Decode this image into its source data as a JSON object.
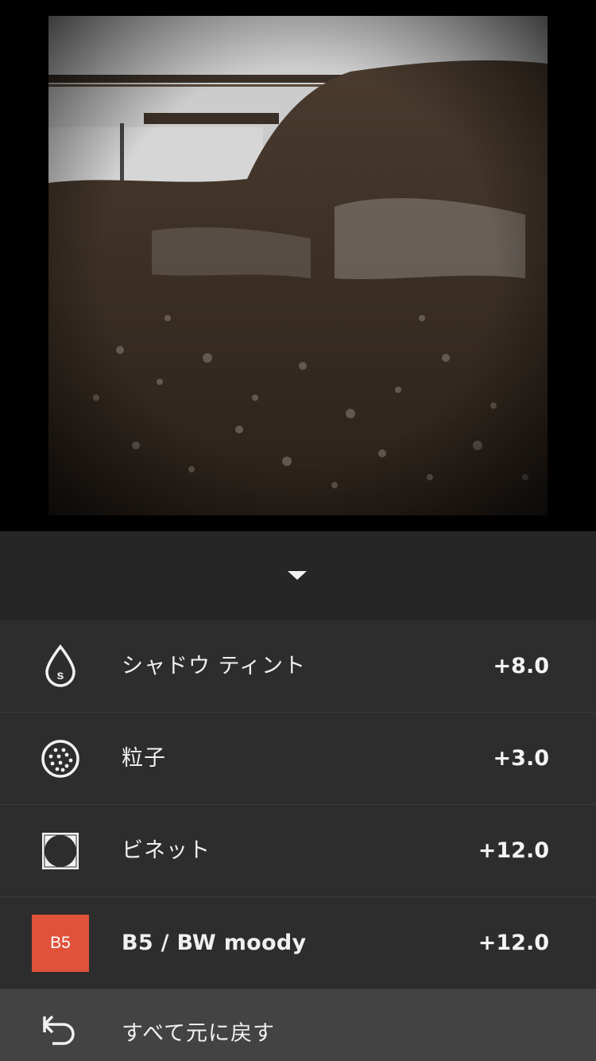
{
  "photo": {
    "description_icon": "image"
  },
  "collapse": {
    "icon": "chevron-down-icon"
  },
  "adjustments": [
    {
      "label": "シャドウ ティント",
      "value": "+8.0",
      "icon": "drop-s-icon"
    },
    {
      "label": "粒子",
      "value": "+3.0",
      "icon": "grain-icon"
    },
    {
      "label": "ビネット",
      "value": "+12.0",
      "icon": "vignette-icon"
    }
  ],
  "filter": {
    "badge": "B5",
    "label": "B5 / BW moody",
    "value": "+12.0",
    "badge_color": "#e0533a"
  },
  "reset": {
    "label": "すべて元に戻す",
    "icon": "undo-icon"
  }
}
